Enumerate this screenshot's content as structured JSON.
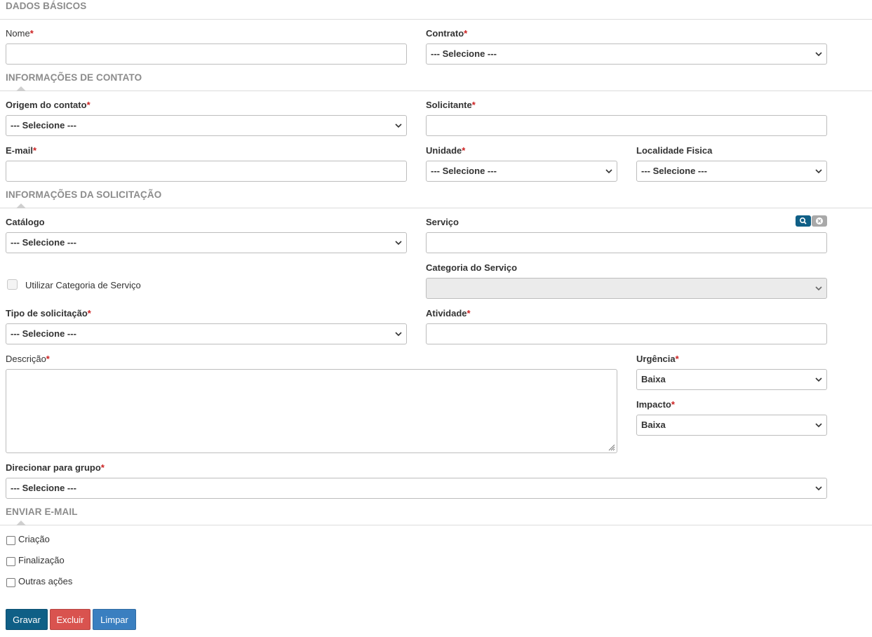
{
  "colors": {
    "primary": "#0f5f86",
    "danger": "#d9534f",
    "info": "#3a7fc0",
    "required": "#cc2222",
    "section_title": "#8c8c8c",
    "clear_icon_bg": "#a9a9a9"
  },
  "sections": {
    "dados_basicos": "DADOS BÁSICOS",
    "contato": "INFORMAÇÕES DE CONTATO",
    "solicitacao": "INFORMAÇÕES DA SOLICITAÇÃO",
    "enviar_email": "ENVIAR E-MAIL"
  },
  "required_mark": "*",
  "fields": {
    "nome": {
      "label": "Nome",
      "value": ""
    },
    "contrato": {
      "label": "Contrato",
      "value": "--- Selecione ---"
    },
    "origem": {
      "label": "Origem do contato",
      "value": "--- Selecione ---"
    },
    "solicitante": {
      "label": "Solicitante",
      "value": ""
    },
    "email": {
      "label": "E-mail",
      "value": ""
    },
    "unidade": {
      "label": "Unidade",
      "value": "--- Selecione ---"
    },
    "localidade": {
      "label": "Localidade Fisica",
      "value": "--- Selecione ---"
    },
    "catalogo": {
      "label": "Catálogo",
      "value": "--- Selecione ---"
    },
    "servico": {
      "label": "Serviço",
      "value": "",
      "search_icon": "search-icon",
      "clear_icon": "clear-icon"
    },
    "utilizar_categoria": {
      "label": "Utilizar Categoria de Serviço",
      "checked": false
    },
    "categoria": {
      "label": "Categoria do Serviço",
      "value": "",
      "disabled": true
    },
    "tipo": {
      "label": "Tipo de solicitação",
      "value": "--- Selecione ---"
    },
    "atividade": {
      "label": "Atividade",
      "value": ""
    },
    "descricao": {
      "label": "Descrição",
      "value": ""
    },
    "urgencia": {
      "label": "Urgência",
      "value": "Baixa"
    },
    "impacto": {
      "label": "Impacto",
      "value": "Baixa"
    },
    "grupo": {
      "label": "Direcionar para grupo",
      "value": "--- Selecione ---"
    }
  },
  "email_options": [
    {
      "label": "Criação",
      "checked": false
    },
    {
      "label": "Finalização",
      "checked": false
    },
    {
      "label": "Outras ações",
      "checked": false
    }
  ],
  "buttons": {
    "gravar": "Gravar",
    "excluir": "Excluir",
    "limpar": "Limpar"
  }
}
